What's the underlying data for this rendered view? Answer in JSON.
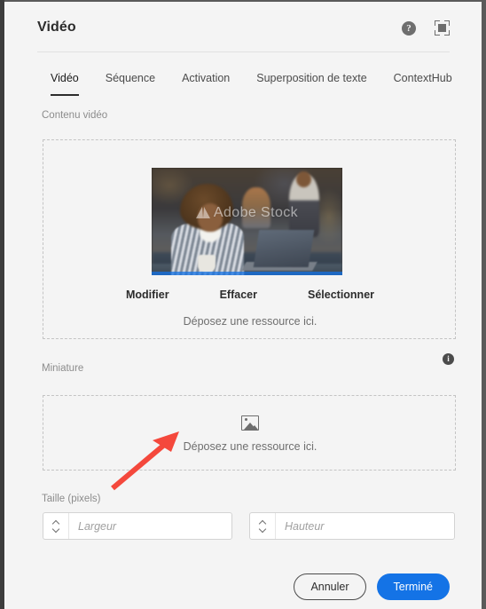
{
  "window": {
    "title": "Vidéo",
    "accent_color": "#1473e6",
    "panel_background": "#f4f4f4"
  },
  "header": {
    "title": "Vidéo",
    "help_glyph": "?",
    "help_icon_name": "help-icon",
    "fullscreen_icon_name": "fullscreen-icon"
  },
  "tabs": [
    {
      "label": "Vidéo",
      "active": true
    },
    {
      "label": "Séquence",
      "active": false
    },
    {
      "label": "Activation",
      "active": false
    },
    {
      "label": "Superposition de texte",
      "active": false
    },
    {
      "label": "ContextHub",
      "active": false
    }
  ],
  "video_section": {
    "label": "Contenu vidéo",
    "preview_watermark": "Adobe Stock",
    "actions": [
      "Modifier",
      "Effacer",
      "Sélectionner"
    ],
    "drop_hint": "Déposez une ressource ici."
  },
  "thumbnail_section": {
    "label": "Miniature",
    "info_glyph": "i",
    "placeholder_icon": "image-placeholder-icon",
    "drop_hint": "Déposez une ressource ici."
  },
  "size_section": {
    "label": "Taille (pixels)",
    "width_field": {
      "value": "",
      "placeholder": "Largeur"
    },
    "height_field": {
      "value": "",
      "placeholder": "Hauteur"
    }
  },
  "footer": {
    "cancel_label": "Annuler",
    "done_label": "Terminé"
  },
  "annotation": {
    "type": "arrow",
    "color": "#f4483c",
    "points_to": "thumbnail-dropzone"
  }
}
